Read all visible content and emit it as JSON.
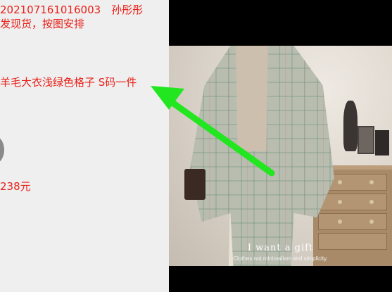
{
  "chat": {
    "order_line": "202107161016003　孙彤彤",
    "ship_line": "发现货，按图安排",
    "item_line": "羊毛大衣浅绿色格子 S码一件",
    "price_line": "238元"
  },
  "viewer": {
    "caption_main": "I want a gift",
    "caption_sub": "Clothes not minimalism and simplicity."
  },
  "colors": {
    "annotation_red": "#e8211a",
    "arrow_green": "#22e620"
  }
}
